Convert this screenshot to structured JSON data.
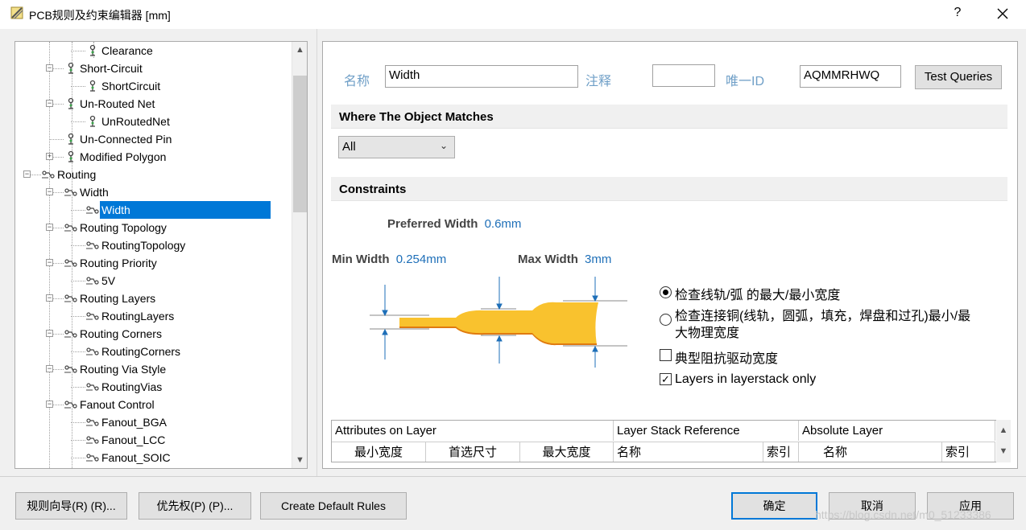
{
  "window": {
    "title": "PCB规则及约束编辑器 [mm]",
    "help_label": "?"
  },
  "tree": {
    "items": [
      {
        "label": "Clearance",
        "level": 3,
        "icon": "rule-icon"
      },
      {
        "label": "Short-Circuit",
        "level": 2,
        "icon": "rule-category-icon",
        "expander": "⊟"
      },
      {
        "label": "ShortCircuit",
        "level": 3,
        "icon": "rule-icon"
      },
      {
        "label": "Un-Routed Net",
        "level": 2,
        "icon": "rule-category-icon",
        "expander": "⊟"
      },
      {
        "label": "UnRoutedNet",
        "level": 3,
        "icon": "rule-icon"
      },
      {
        "label": "Un-Connected Pin",
        "level": 2,
        "icon": "rule-category-icon"
      },
      {
        "label": "Modified Polygon",
        "level": 2,
        "icon": "rule-category-icon",
        "expander": "⊞"
      },
      {
        "label": "Routing",
        "level": 1,
        "icon": "routing-icon",
        "expander": "⊟"
      },
      {
        "label": "Width",
        "level": 2,
        "icon": "routing-rule-icon",
        "expander": "⊟"
      },
      {
        "label": "Width",
        "level": 3,
        "icon": "routing-rule-icon",
        "selected": true
      },
      {
        "label": "Routing Topology",
        "level": 2,
        "icon": "routing-rule-icon",
        "expander": "⊟"
      },
      {
        "label": "RoutingTopology",
        "level": 3,
        "icon": "routing-rule-icon"
      },
      {
        "label": "Routing Priority",
        "level": 2,
        "icon": "routing-rule-icon",
        "expander": "⊟"
      },
      {
        "label": "5V",
        "level": 3,
        "icon": "routing-rule-icon"
      },
      {
        "label": "Routing Layers",
        "level": 2,
        "icon": "routing-rule-icon",
        "expander": "⊟"
      },
      {
        "label": "RoutingLayers",
        "level": 3,
        "icon": "routing-rule-icon"
      },
      {
        "label": "Routing Corners",
        "level": 2,
        "icon": "routing-rule-icon",
        "expander": "⊟"
      },
      {
        "label": "RoutingCorners",
        "level": 3,
        "icon": "routing-rule-icon"
      },
      {
        "label": "Routing Via Style",
        "level": 2,
        "icon": "routing-rule-icon",
        "expander": "⊟"
      },
      {
        "label": "RoutingVias",
        "level": 3,
        "icon": "routing-rule-icon"
      },
      {
        "label": "Fanout Control",
        "level": 2,
        "icon": "routing-rule-icon",
        "expander": "⊟"
      },
      {
        "label": "Fanout_BGA",
        "level": 3,
        "icon": "routing-rule-icon"
      },
      {
        "label": "Fanout_LCC",
        "level": 3,
        "icon": "routing-rule-icon"
      },
      {
        "label": "Fanout_SOIC",
        "level": 3,
        "icon": "routing-rule-icon"
      }
    ]
  },
  "rule": {
    "name_label": "名称",
    "name_value": "Width",
    "comment_label": "注释",
    "comment_value": "",
    "uid_label": "唯一ID",
    "uid_value": "AQMMRHWQ",
    "test_queries": "Test Queries"
  },
  "match": {
    "header": "Where The Object Matches",
    "selected": "All"
  },
  "constraints": {
    "header": "Constraints",
    "preferred_label": "Preferred Width",
    "preferred_value": "0.6mm",
    "min_label": "Min Width",
    "min_value": "0.254mm",
    "max_label": "Max Width",
    "max_value": "3mm",
    "track_color": "#f9c22e",
    "opt1": "检查线轨/弧 的最大/最小宽度",
    "opt2_line1": "检查连接铜(线轨，圆弧，填充，焊盘和过孔)最小/最",
    "opt2_line2": "大物理宽度",
    "chk1": "典型阻抗驱动宽度",
    "chk2": "Layers in layerstack only",
    "chk2_mark": "✓"
  },
  "grid": {
    "group1": "Attributes on Layer",
    "group2": "Layer Stack Reference",
    "group3": "Absolute Layer",
    "col_min": "最小宽度",
    "col_pref": "首选尺寸",
    "col_max": "最大宽度",
    "col_name": "名称",
    "col_index": "索引",
    "col_name2": "名称",
    "col_index2": "索引"
  },
  "buttons": {
    "wizard": "规则向导(R) (R)...",
    "priority": "优先权(P) (P)...",
    "defaults": "Create Default Rules",
    "ok": "确定",
    "cancel": "取消",
    "apply": "应用"
  },
  "watermark": "https://blog.csdn.net/m0_51233386"
}
